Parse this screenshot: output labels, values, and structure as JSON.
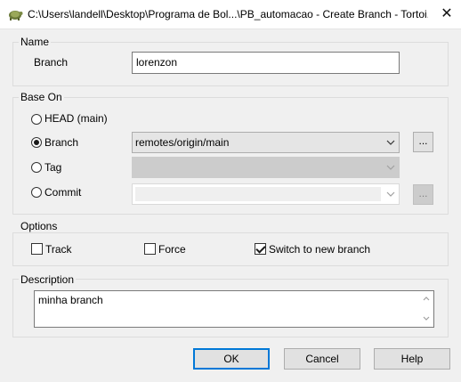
{
  "window": {
    "title": "C:\\Users\\landell\\Desktop\\Programa de Bol...\\PB_automacao - Create Branch - Tortoi...",
    "close_symbol": "✕",
    "icon": "tortoisegit-icon"
  },
  "name_group": {
    "legend": "Name",
    "branch_label": "Branch",
    "branch_value": "lorenzon"
  },
  "base_on_group": {
    "legend": "Base On",
    "options": {
      "head": {
        "label": "HEAD (main)",
        "selected": false
      },
      "branch": {
        "label": "Branch",
        "selected": true,
        "combo_value": "remotes/origin/main",
        "browse_label": "..."
      },
      "tag": {
        "label": "Tag",
        "selected": false,
        "combo_value": ""
      },
      "commit": {
        "label": "Commit",
        "selected": false,
        "combo_value": "",
        "browse_label": "..."
      }
    }
  },
  "options_group": {
    "legend": "Options",
    "track": {
      "label": "Track",
      "checked": false
    },
    "force": {
      "label": "Force",
      "checked": false
    },
    "switch": {
      "label": "Switch to new branch",
      "checked": true
    }
  },
  "description_group": {
    "legend": "Description",
    "value": "minha branch"
  },
  "buttons": {
    "ok": "OK",
    "cancel": "Cancel",
    "help": "Help"
  },
  "colors": {
    "dialog_bg": "#f0f0f0",
    "default_button_border": "#0078d7"
  }
}
